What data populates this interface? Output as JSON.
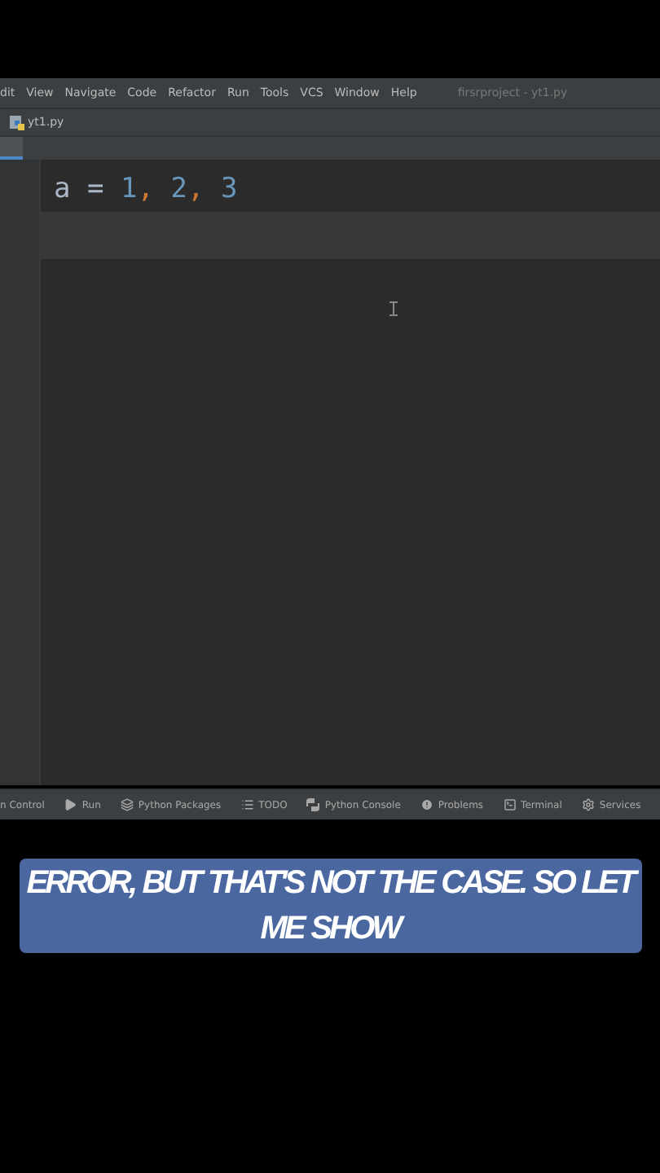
{
  "menu": [
    "dit",
    "View",
    "Navigate",
    "Code",
    "Refactor",
    "Run",
    "Tools",
    "VCS",
    "Window",
    "Help"
  ],
  "window": {
    "title": "firsrproject - yt1.py"
  },
  "breadcrumb": {
    "file": "yt1.py"
  },
  "editor": {
    "lines": [
      {
        "current": false,
        "tokens": [
          {
            "kind": "name",
            "text": "a"
          },
          {
            "kind": "op",
            "text": " = "
          },
          {
            "kind": "num",
            "text": "1"
          },
          {
            "kind": "punct",
            "text": ", "
          },
          {
            "kind": "num",
            "text": "2"
          },
          {
            "kind": "punct",
            "text": ", "
          },
          {
            "kind": "num",
            "text": "3"
          }
        ]
      },
      {
        "current": true
      }
    ]
  },
  "tool_windows": [
    {
      "kind": "none",
      "label": "n Control"
    },
    {
      "kind": "run",
      "label": "Run"
    },
    {
      "kind": "packages",
      "label": "Python Packages"
    },
    {
      "kind": "todo",
      "label": "TODO"
    },
    {
      "kind": "console",
      "label": "Python Console"
    },
    {
      "kind": "problems",
      "label": "Problems"
    },
    {
      "kind": "terminal",
      "label": "Terminal"
    },
    {
      "kind": "services",
      "label": "Services"
    }
  ],
  "caption": "ERROR, BUT THAT'S NOT THE CASE. SO LET ME SHOW"
}
